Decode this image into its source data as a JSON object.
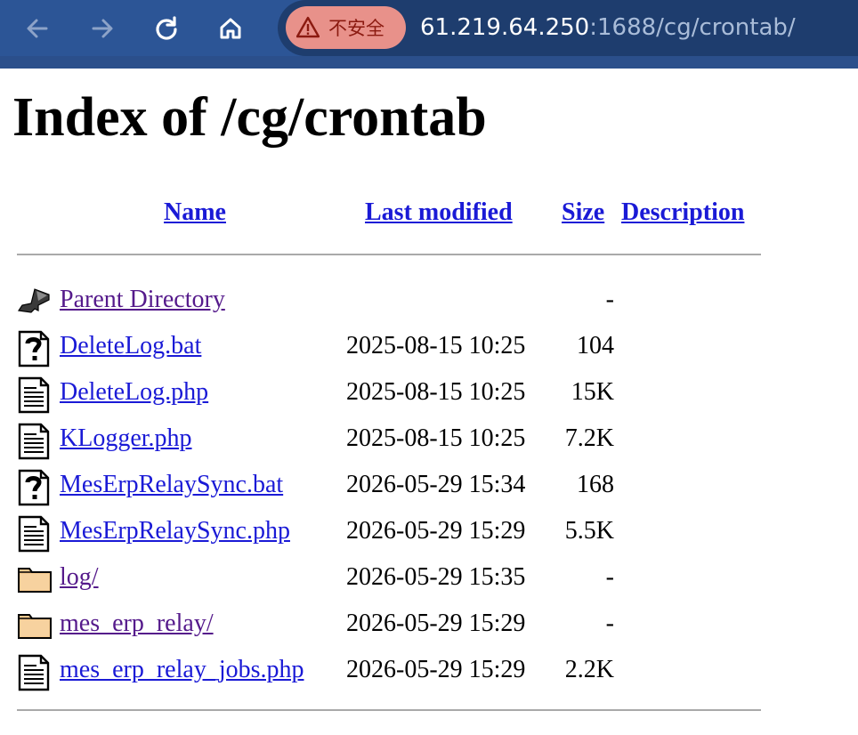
{
  "browser": {
    "security_label": "不安全",
    "url_host": "61.219.64.250",
    "url_rest": ":1688/cg/crontab/"
  },
  "page": {
    "title": "Index of /cg/crontab",
    "columns": {
      "name": "Name",
      "last_modified": "Last modified",
      "size": "Size",
      "description": "Description"
    },
    "entries": [
      {
        "name": "Parent Directory",
        "modified": "",
        "size": "-",
        "icon": "back-icon",
        "visited": true
      },
      {
        "name": "DeleteLog.bat",
        "modified": "2025-08-15 10:25",
        "size": "104",
        "icon": "unknown-file-icon",
        "visited": false
      },
      {
        "name": "DeleteLog.php",
        "modified": "2025-08-15 10:25",
        "size": "15K",
        "icon": "text-file-icon",
        "visited": false
      },
      {
        "name": "KLogger.php",
        "modified": "2025-08-15 10:25",
        "size": "7.2K",
        "icon": "text-file-icon",
        "visited": false
      },
      {
        "name": "MesErpRelaySync.bat",
        "modified": "2026-05-29 15:34",
        "size": "168",
        "icon": "unknown-file-icon",
        "visited": false
      },
      {
        "name": "MesErpRelaySync.php",
        "modified": "2026-05-29 15:29",
        "size": "5.5K",
        "icon": "text-file-icon",
        "visited": false
      },
      {
        "name": "log/",
        "modified": "2026-05-29 15:35",
        "size": "-",
        "icon": "folder-icon",
        "visited": true
      },
      {
        "name": "mes_erp_relay/",
        "modified": "2026-05-29 15:29",
        "size": "-",
        "icon": "folder-icon",
        "visited": true
      },
      {
        "name": "mes_erp_relay_jobs.php",
        "modified": "2026-05-29 15:29",
        "size": "2.2K",
        "icon": "text-file-icon",
        "visited": false
      }
    ]
  }
}
